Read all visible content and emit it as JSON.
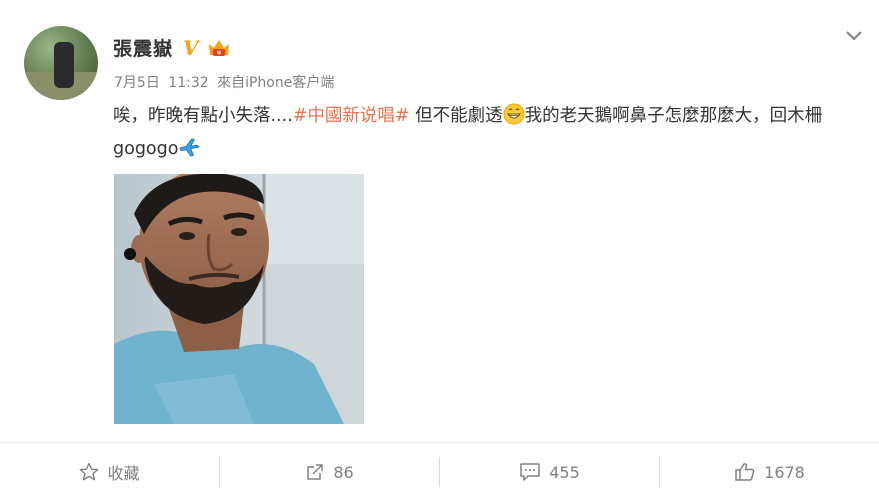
{
  "post": {
    "author": "張震嶽",
    "meta": {
      "date": "7月5日",
      "time": "11:32",
      "source": "來自iPhone客户端"
    },
    "text": {
      "part1": "唉，昨晚有點小失落....",
      "topic": "#中國新说唱#",
      "part2": " 但不能劇透",
      "part3": "我的老天鵝啊鼻子怎麼那麼大，回木柵gogogo"
    }
  },
  "icons": {
    "verified": "verified-v-icon",
    "member": "member-crown-icon",
    "menu": "chevron-down-icon",
    "grin": "grin-emoji-icon",
    "plane": "airplane-emoji-icon"
  },
  "footer": {
    "favorite_label": "收藏",
    "repost_count": "86",
    "comment_count": "455",
    "like_count": "1678"
  },
  "colors": {
    "topic": "#eb7350",
    "verified": "#f7a10f",
    "meta": "#808080"
  }
}
